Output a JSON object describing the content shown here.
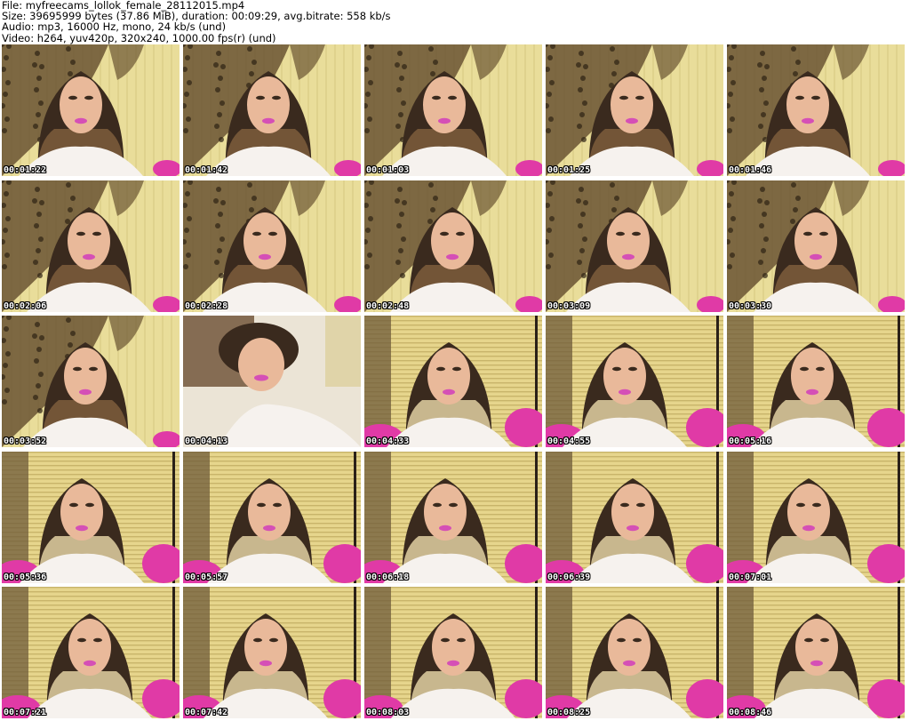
{
  "header": {
    "file_line": "File: myfreecams_lollok_female_28112015.mp4",
    "size_line": "Size: 39695999 bytes (37.86 MiB), duration: 00:09:29, avg.bitrate: 558 kb/s",
    "audio_line": "Audio: mp3, 16000 Hz, mono, 24 kb/s (und)",
    "video_line": "Video: h264, yuv420p, 320x240, 1000.00 fps(r) (und)"
  },
  "thumbnails": [
    {
      "timestamp": "00:01:22",
      "scene": "curtain"
    },
    {
      "timestamp": "00:01:42",
      "scene": "curtain"
    },
    {
      "timestamp": "00:01:03",
      "scene": "curtain"
    },
    {
      "timestamp": "00:01:25",
      "scene": "curtain"
    },
    {
      "timestamp": "00:01:46",
      "scene": "curtain"
    },
    {
      "timestamp": "00:02:06",
      "scene": "curtain"
    },
    {
      "timestamp": "00:02:28",
      "scene": "curtain"
    },
    {
      "timestamp": "00:02:48",
      "scene": "curtain"
    },
    {
      "timestamp": "00:03:09",
      "scene": "curtain"
    },
    {
      "timestamp": "00:03:30",
      "scene": "curtain"
    },
    {
      "timestamp": "00:03:52",
      "scene": "curtain"
    },
    {
      "timestamp": "00:04:13",
      "scene": "closeup"
    },
    {
      "timestamp": "00:04:33",
      "scene": "blinds"
    },
    {
      "timestamp": "00:04:55",
      "scene": "blinds"
    },
    {
      "timestamp": "00:05:16",
      "scene": "blinds"
    },
    {
      "timestamp": "00:05:36",
      "scene": "blinds"
    },
    {
      "timestamp": "00:05:57",
      "scene": "blinds"
    },
    {
      "timestamp": "00:06:18",
      "scene": "blinds"
    },
    {
      "timestamp": "00:06:39",
      "scene": "blinds"
    },
    {
      "timestamp": "00:07:01",
      "scene": "blinds"
    },
    {
      "timestamp": "00:07:21",
      "scene": "blinds"
    },
    {
      "timestamp": "00:07:42",
      "scene": "blinds"
    },
    {
      "timestamp": "00:08:03",
      "scene": "blinds"
    },
    {
      "timestamp": "00:08:25",
      "scene": "blinds"
    },
    {
      "timestamp": "00:08:46",
      "scene": "blinds"
    }
  ],
  "colors": {
    "curtain_bg": "#e9dd9a",
    "curtain_pattern": "#6a5432",
    "blinds_bg": "#e6d58c",
    "blinds_line": "#c8b46a",
    "hair_dark": "#3a2a1e",
    "hair_light": "#d8c79a",
    "skin": "#e9b99a",
    "lips": "#d54fb6",
    "pillow": "#e03aa6",
    "shirt": "#f6f2ee"
  }
}
